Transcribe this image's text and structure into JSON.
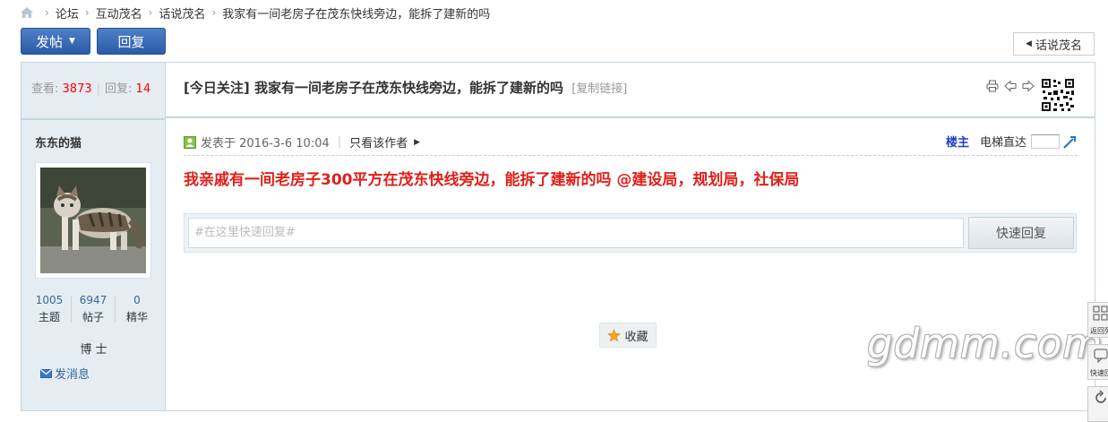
{
  "breadcrumb": {
    "items": [
      "论坛",
      "互动茂名",
      "话说茂名",
      "我家有一间老房子在茂东快线旁边，能拆了建新的吗"
    ]
  },
  "toolbar": {
    "post_label": "发帖",
    "reply_label": "回复",
    "back_label": "话说茂名"
  },
  "thread_stats": {
    "views_label": "查看:",
    "views": "3873",
    "replies_label": "回复:",
    "replies": "14"
  },
  "thread": {
    "tag": "[今日关注]",
    "title": "我家有一间老房子在茂东快线旁边，能拆了建新的吗",
    "copy_link": "[复制链接]"
  },
  "author": {
    "name": "东东的猫",
    "topics": "1005",
    "topics_label": "主题",
    "posts": "6947",
    "posts_label": "帖子",
    "digest": "0",
    "digest_label": "精华",
    "rank": "博 士",
    "send_message": "发消息"
  },
  "post": {
    "posted_at": "发表于 2016-3-6 10:04",
    "only_author": "只看该作者",
    "floor": "楼主",
    "jump_label": "电梯直达",
    "body": "我亲戚有一间老房子300平方在茂东快线旁边，能拆了建新的吗  @建设局，规划局，社保局"
  },
  "quick_reply": {
    "placeholder": "#在这里快速回复#",
    "submit_label": "快速回复"
  },
  "favorite_label": "收藏",
  "watermark": "gdmm.com",
  "float_tools": [
    "返回列表",
    "快速回复"
  ],
  "colors": {
    "accent_blue": "#2b5ca8",
    "stat_red": "#ff0000",
    "body_red": "#e0201c",
    "side_bg": "#e5edf2",
    "border": "#c2d5e3",
    "floor_blue": "#1c3ec7"
  },
  "icons": [
    "home-icon",
    "print-icon",
    "prev-icon",
    "next-icon",
    "qr-code",
    "online-status-icon",
    "jump-go-icon",
    "mail-icon",
    "star-icon",
    "list-icon",
    "reply-icon"
  ]
}
